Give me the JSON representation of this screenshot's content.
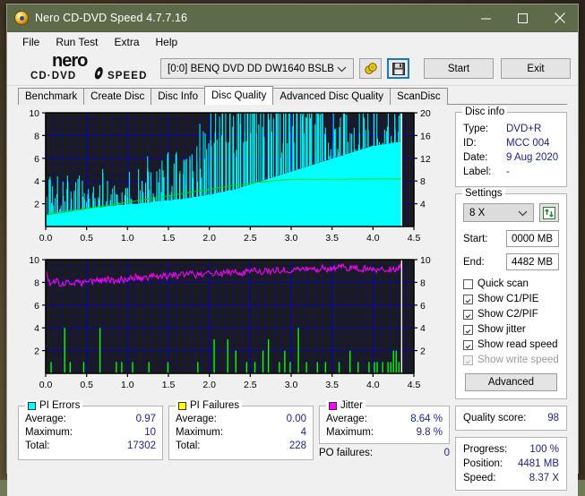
{
  "window": {
    "title": "Nero CD-DVD Speed 4.7.7.16",
    "icon": "nero-disc-icon",
    "buttons": {
      "minimize": "minimize-icon",
      "maximize": "maximize-icon",
      "close": "close-icon"
    }
  },
  "menu": {
    "items": [
      "File",
      "Run Test",
      "Extra",
      "Help"
    ]
  },
  "toolbar": {
    "logo_main": "nero",
    "logo_sub": "CD·DVD SPEED",
    "drive": "[0:0]   BENQ DVD DD DW1640 BSLB",
    "eject_icon": "eject-disc-icon",
    "save_icon": "floppy-save-icon",
    "start_label": "Start",
    "exit_label": "Exit"
  },
  "tabs": {
    "items": [
      "Benchmark",
      "Create Disc",
      "Disc Info",
      "Disc Quality",
      "Advanced Disc Quality",
      "ScanDisc"
    ],
    "active": "Disc Quality"
  },
  "disc_info": {
    "title": "Disc info",
    "rows": [
      {
        "key": "Type:",
        "value": "DVD+R"
      },
      {
        "key": "ID:",
        "value": "MCC 004"
      },
      {
        "key": "Date:",
        "value": "9 Aug 2020"
      },
      {
        "key": "Label:",
        "value": "-"
      }
    ]
  },
  "settings": {
    "title": "Settings",
    "speed": "8 X",
    "refresh_icon": "refresh-arrows-icon",
    "start_label": "Start:",
    "start_value": "0000 MB",
    "end_label": "End:",
    "end_value": "4482 MB",
    "checkboxes": [
      {
        "label": "Quick scan",
        "checked": false,
        "disabled": false
      },
      {
        "label": "Show C1/PIE",
        "checked": true,
        "disabled": false
      },
      {
        "label": "Show C2/PIF",
        "checked": true,
        "disabled": false
      },
      {
        "label": "Show jitter",
        "checked": true,
        "disabled": false
      },
      {
        "label": "Show read speed",
        "checked": true,
        "disabled": false
      },
      {
        "label": "Show write speed",
        "checked": true,
        "disabled": true
      }
    ],
    "advanced_label": "Advanced"
  },
  "quality": {
    "label": "Quality score:",
    "value": "98"
  },
  "progress_panel": {
    "rows": [
      {
        "key": "Progress:",
        "value": "100 %"
      },
      {
        "key": "Position:",
        "value": "4481 MB"
      },
      {
        "key": "Speed:",
        "value": "8.37 X"
      }
    ]
  },
  "stats": {
    "pi_errors": {
      "title": "PI Errors",
      "color": "#00ffff",
      "rows": [
        {
          "key": "Average:",
          "value": "0.97"
        },
        {
          "key": "Maximum:",
          "value": "10"
        },
        {
          "key": "Total:",
          "value": "17302"
        }
      ]
    },
    "pi_failures": {
      "title": "PI Failures",
      "color": "#ffff00",
      "rows": [
        {
          "key": "Average:",
          "value": "0.00"
        },
        {
          "key": "Maximum:",
          "value": "4"
        },
        {
          "key": "Total:",
          "value": "228"
        }
      ]
    },
    "jitter": {
      "title": "Jitter",
      "color": "#ff00ff",
      "rows": [
        {
          "key": "Average:",
          "value": "8.64 %"
        },
        {
          "key": "Maximum:",
          "value": "9.8 %"
        }
      ],
      "po_key": "PO failures:",
      "po_value": "0"
    }
  },
  "chart_data": [
    {
      "id": "pi-errors-chart",
      "type": "area",
      "title": "PI Errors / Read speed",
      "xlabel": "",
      "ylabel": "PI Errors",
      "xlim": [
        0.0,
        4.5
      ],
      "ylim": [
        0,
        10
      ],
      "y2lim": [
        0,
        20
      ],
      "xticks": [
        0.0,
        0.5,
        1.0,
        1.5,
        2.0,
        2.5,
        3.0,
        3.5,
        4.0,
        4.5
      ],
      "yticks": [
        2,
        4,
        6,
        8,
        10
      ],
      "y2ticks": [
        4,
        8,
        12,
        16,
        20
      ],
      "grid": true,
      "background": "#1c1c1c",
      "gridcolor": "#0000d0",
      "series": [
        {
          "name": "PI Errors",
          "color": "#00ffff",
          "kind": "area-spikes",
          "baseline": [
            1.0,
            1.1,
            1.2,
            1.2,
            1.3,
            1.3,
            1.4,
            1.4,
            1.5,
            1.5,
            1.5,
            1.6,
            1.6,
            1.6,
            1.7,
            1.7,
            1.7,
            1.8,
            1.8,
            1.8,
            1.9,
            1.9,
            1.9,
            2.0,
            2.0,
            2.0,
            2.0,
            2.1,
            2.1,
            2.1,
            2.2,
            2.2,
            2.2,
            2.3,
            2.3,
            2.3,
            2.4,
            2.4,
            2.4,
            2.5,
            2.5,
            2.6,
            2.6,
            2.7,
            2.7,
            2.8,
            2.8,
            2.9,
            3.0,
            3.0,
            3.1,
            3.2,
            3.2,
            3.3,
            3.4,
            3.5,
            3.6,
            3.7,
            3.8,
            3.9,
            4.0,
            4.1,
            4.2,
            4.3,
            4.4,
            4.5,
            4.6,
            4.7,
            4.8,
            4.9,
            5.0,
            5.1,
            5.2,
            5.3,
            5.4,
            5.5,
            5.6,
            5.7,
            5.8,
            5.9,
            6.0,
            6.1,
            6.2,
            6.3,
            6.4,
            6.5,
            6.6,
            6.7,
            6.8,
            6.9,
            7.0,
            7.1,
            7.1,
            7.2,
            7.2,
            7.3,
            7.3,
            7.4,
            7.4,
            7.5
          ],
          "peaks": [
            3,
            6,
            4,
            5,
            3,
            4,
            5,
            3,
            4,
            5,
            4,
            3,
            5,
            4,
            3,
            4,
            5,
            4,
            3,
            5,
            4,
            3,
            4,
            5,
            4,
            3,
            5,
            4,
            6,
            5,
            4,
            5,
            6,
            5,
            7,
            6,
            8,
            7,
            6,
            8,
            9,
            8,
            7,
            9,
            10,
            11,
            12,
            11,
            10,
            12,
            13,
            12,
            11,
            13,
            12,
            14,
            13,
            12,
            16,
            13,
            12,
            14,
            13,
            12,
            14,
            13,
            12,
            15,
            14,
            13,
            20,
            16,
            14,
            13,
            12,
            14,
            13,
            12,
            11,
            13,
            12,
            11,
            12,
            13,
            12,
            11,
            10,
            12,
            11,
            10,
            11,
            12,
            13,
            11,
            10,
            12,
            11,
            10,
            12,
            13
          ]
        },
        {
          "name": "Read speed",
          "color": "#00e000",
          "kind": "line",
          "axis": "right",
          "values": [
            2.0,
            2.1,
            2.2,
            2.3,
            2.4,
            2.5,
            2.6,
            2.7,
            2.8,
            2.9,
            3.0,
            3.1,
            3.2,
            3.3,
            3.4,
            3.5,
            3.6,
            3.7,
            3.8,
            3.9,
            4.0,
            4.1,
            4.2,
            4.3,
            4.4,
            4.5,
            4.6,
            4.7,
            4.8,
            4.9,
            5.0,
            5.1,
            5.2,
            5.3,
            5.4,
            5.5,
            5.6,
            5.7,
            5.8,
            5.9,
            6.0,
            6.1,
            6.2,
            6.3,
            6.4,
            6.5,
            6.6,
            6.7,
            6.8,
            6.9,
            7.0,
            7.1,
            7.2,
            7.3,
            7.4,
            7.4,
            7.5,
            7.6,
            7.7,
            7.8,
            7.8,
            7.9,
            8.0,
            8.0,
            8.1,
            8.1,
            8.2,
            8.2,
            8.3,
            8.3,
            8.3,
            8.3,
            8.3,
            8.3,
            8.3,
            8.3,
            8.3,
            8.3,
            8.3,
            8.3,
            8.3,
            8.3,
            8.3,
            8.3,
            8.3,
            8.35,
            8.35,
            8.35,
            8.35,
            8.35,
            8.37,
            8.37,
            8.37,
            8.37,
            8.37,
            8.37,
            8.37,
            8.37,
            8.37,
            8.37
          ]
        }
      ],
      "endmarker": {
        "x": 4.35,
        "color": "#ffffff"
      }
    },
    {
      "id": "jitter-pif-chart",
      "type": "line",
      "title": "Jitter / PI Failures",
      "xlabel": "",
      "ylabel": "",
      "xlim": [
        0.0,
        4.5
      ],
      "ylim": [
        0,
        10
      ],
      "xticks": [
        0.0,
        0.5,
        1.0,
        1.5,
        2.0,
        2.5,
        3.0,
        3.5,
        4.0,
        4.5
      ],
      "yticks": [
        2,
        4,
        6,
        8,
        10
      ],
      "grid": true,
      "background": "#1c1c1c",
      "gridcolor": "#0000d0",
      "series": [
        {
          "name": "Jitter",
          "color": "#ff00ff",
          "kind": "line",
          "values": [
            9.4,
            8.0,
            7.9,
            8.1,
            7.8,
            7.9,
            8.0,
            7.8,
            7.9,
            8.0,
            7.8,
            8.0,
            8.1,
            8.0,
            8.3,
            8.2,
            8.1,
            8.3,
            8.2,
            8.0,
            8.1,
            8.3,
            8.2,
            8.4,
            8.3,
            8.5,
            8.4,
            8.3,
            8.5,
            8.4,
            8.6,
            8.5,
            8.4,
            8.6,
            8.5,
            8.7,
            8.6,
            8.5,
            8.7,
            8.6,
            8.8,
            8.7,
            8.6,
            8.8,
            8.7,
            8.9,
            8.8,
            8.7,
            8.9,
            8.8,
            9.0,
            8.9,
            8.8,
            9.0,
            8.9,
            8.8,
            9.0,
            8.9,
            9.1,
            9.0,
            8.9,
            9.1,
            9.0,
            8.9,
            9.1,
            9.0,
            9.2,
            9.1,
            9.0,
            9.2,
            9.1,
            9.0,
            9.2,
            9.1,
            9.3,
            9.2,
            9.1,
            9.3,
            9.2,
            9.1,
            9.3,
            9.2,
            9.4,
            9.3,
            9.2,
            9.4,
            9.3,
            9.2,
            9.1,
            9.3,
            9.2,
            9.1,
            9.0,
            9.2,
            9.1,
            9.0,
            9.2,
            9.1,
            9.3,
            9.4
          ]
        },
        {
          "name": "PI Failures",
          "color": "#00ff00",
          "kind": "bars",
          "values": [
            1,
            0,
            1,
            0,
            0,
            0,
            0,
            4,
            0,
            1,
            0,
            0,
            0,
            0,
            1,
            0,
            0,
            0,
            0,
            0,
            4,
            0,
            0,
            0,
            0,
            0,
            1,
            0,
            1,
            0,
            0,
            0,
            1,
            0,
            0,
            0,
            0,
            0,
            1,
            0,
            0,
            0,
            0,
            0,
            0,
            1,
            0,
            0,
            0,
            0,
            0,
            0,
            0,
            0,
            0,
            0,
            1,
            0,
            0,
            0,
            0,
            0,
            3,
            0,
            0,
            0,
            0,
            3,
            0,
            0,
            2,
            0,
            0,
            0,
            1,
            0,
            0,
            1,
            0,
            0,
            2,
            0,
            3,
            0,
            0,
            0,
            1,
            0,
            2,
            0,
            1,
            0,
            0,
            4,
            0,
            0,
            1,
            0,
            0,
            0,
            1,
            0,
            0,
            1,
            0,
            0,
            0,
            0,
            1,
            0,
            0,
            0,
            2,
            0,
            0,
            1,
            0,
            0,
            0,
            1,
            0,
            1,
            1,
            0,
            1,
            0,
            1,
            1,
            2,
            2,
            1,
            0
          ]
        }
      ],
      "endmarker": {
        "x": 4.35,
        "color": "#ffffff"
      }
    }
  ]
}
